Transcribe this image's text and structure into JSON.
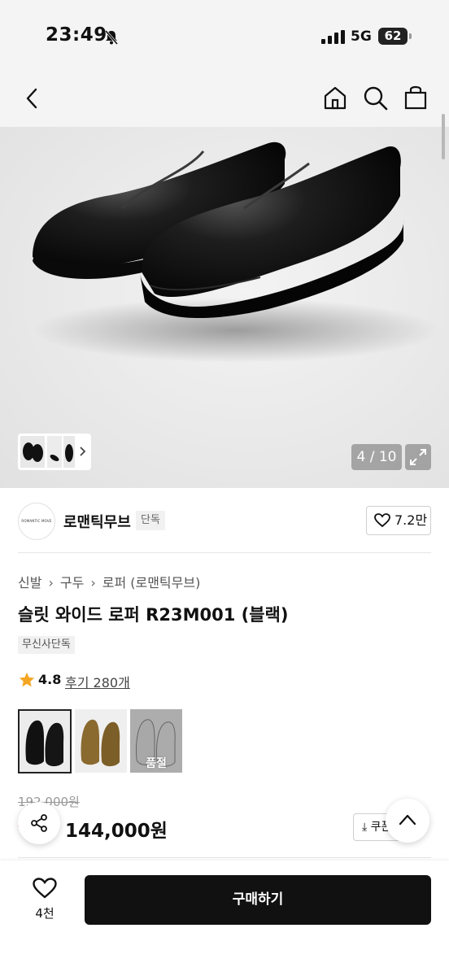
{
  "status_bar": {
    "time": "23:49",
    "network": "5G",
    "battery": "62"
  },
  "gallery": {
    "page": "4 / 10"
  },
  "brand": {
    "name": "로맨틱무브",
    "badge": "단독",
    "likes": "7.2만",
    "logo_text": "ROMANTIC MOVE"
  },
  "breadcrumb": {
    "items": [
      "신발",
      "구두",
      "로퍼 (로맨틱무브)"
    ]
  },
  "product": {
    "title": "슬릿 와이드 로퍼 R23M001 (블랙)",
    "tag": "무신사단독",
    "rating": "4.8",
    "reviews": "후기 280개",
    "soldout_label": "품절",
    "original_price": "192,000원",
    "sale_price": "144,000원",
    "coupon_label": "⤓ 쿠폰"
  },
  "bottom_bar": {
    "wish_count": "4천",
    "buy_label": "구매하기"
  },
  "colors": {
    "accent": "#111111",
    "star": "#f4a623",
    "sale_dot": "#e22222"
  }
}
